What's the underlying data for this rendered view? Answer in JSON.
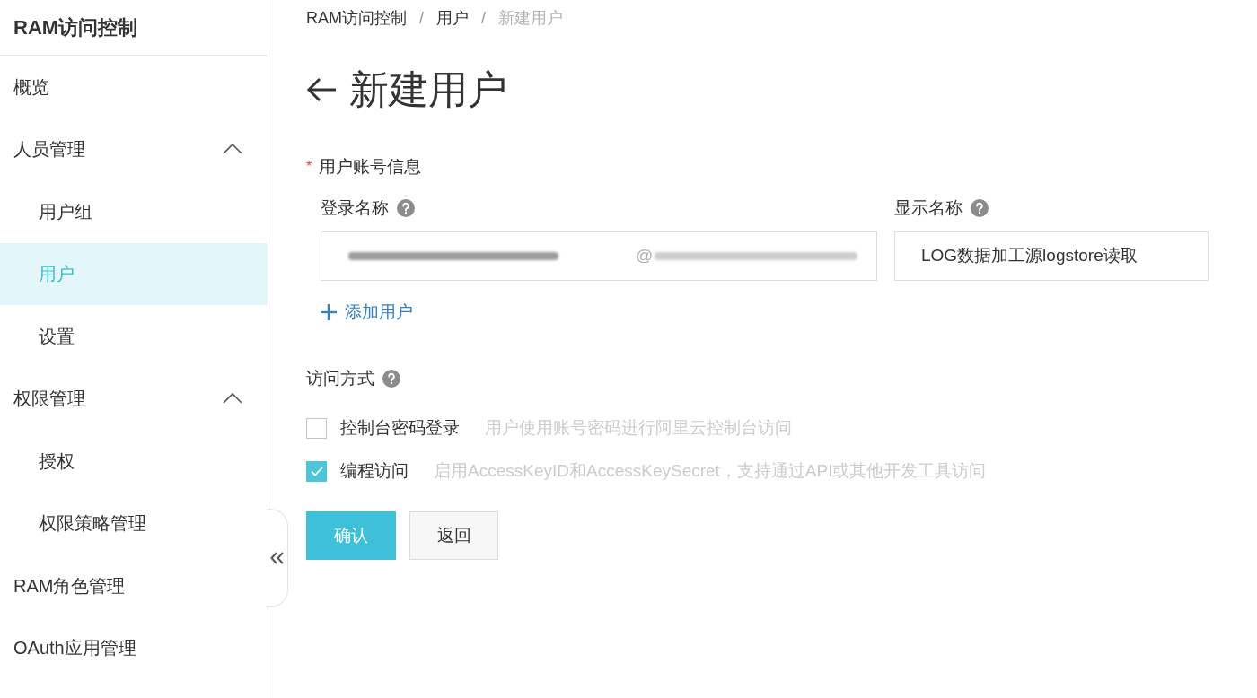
{
  "sidebar": {
    "title": "RAM访问控制",
    "items": [
      {
        "kind": "link",
        "label": "概览",
        "selected": false
      },
      {
        "kind": "group",
        "label": "人员管理",
        "expanded": true,
        "children": [
          {
            "label": "用户组",
            "selected": false
          },
          {
            "label": "用户",
            "selected": true
          },
          {
            "label": "设置",
            "selected": false
          }
        ]
      },
      {
        "kind": "group",
        "label": "权限管理",
        "expanded": true,
        "children": [
          {
            "label": "授权",
            "selected": false
          },
          {
            "label": "权限策略管理",
            "selected": false
          }
        ]
      },
      {
        "kind": "link",
        "label": "RAM角色管理",
        "selected": false
      },
      {
        "kind": "link",
        "label": "OAuth应用管理",
        "selected": false
      }
    ]
  },
  "breadcrumb": {
    "separator": "/",
    "items": [
      {
        "label": "RAM访问控制",
        "current": false
      },
      {
        "label": "用户",
        "current": false
      },
      {
        "label": "新建用户",
        "current": true
      }
    ]
  },
  "page_title": "新建用户",
  "account_section": {
    "required_mark": "*",
    "label": "用户账号信息",
    "fields": [
      {
        "kind": "login",
        "label": "登录名称",
        "help": true,
        "domain_prefix": "@"
      },
      {
        "kind": "text",
        "label": "显示名称",
        "help": true,
        "value": "LOG数据加工源logstore读取"
      }
    ],
    "add_user": "添加用户"
  },
  "access_section": {
    "label": "访问方式",
    "help": true,
    "options": [
      {
        "label": "控制台密码登录",
        "description": "用户使用账号密码进行阿里云控制台访问",
        "checked": false
      },
      {
        "label": "编程访问",
        "description": "启用AccessKeyID和AccessKeySecret，支持通过API或其他开发工具访问",
        "checked": true
      }
    ]
  },
  "buttons": [
    {
      "kind": "primary",
      "label": "确认"
    },
    {
      "kind": "secondary",
      "label": "返回"
    }
  ]
}
